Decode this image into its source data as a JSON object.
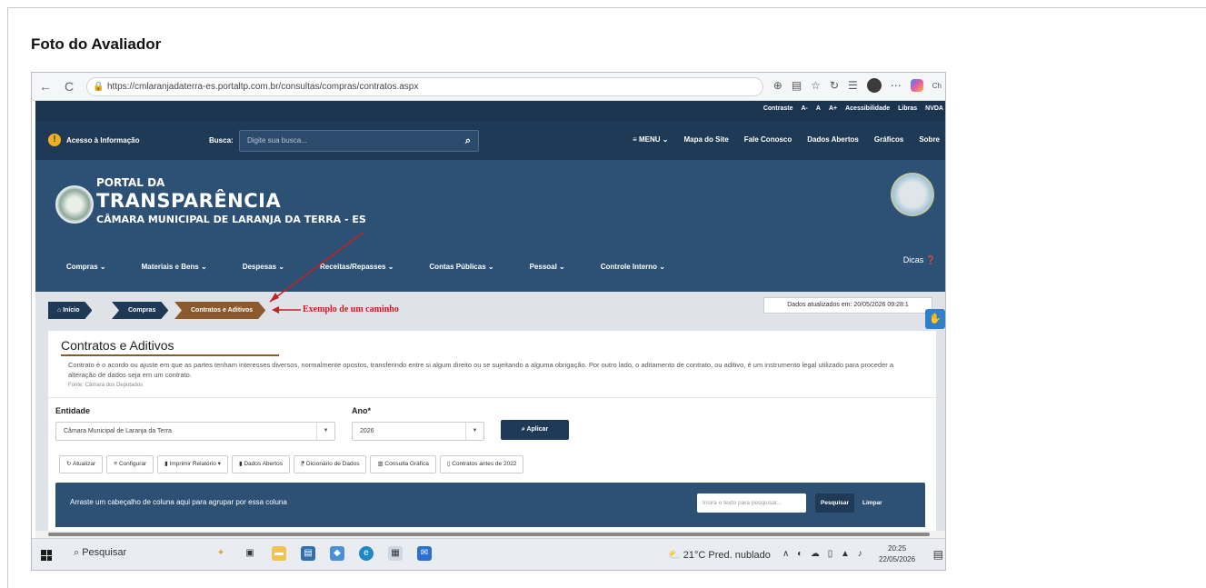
{
  "page": {
    "title": "Foto do Avaliador"
  },
  "browser": {
    "url": "https://cmlaranjadaterra-es.portaltp.com.br/consultas/compras/contratos.aspx",
    "back_icon": "←",
    "reload_icon": "C",
    "profile_label": "Ch"
  },
  "util_bar": {
    "items": [
      "Contraste",
      "A-",
      "A",
      "A+",
      "Acessibilidade",
      "Libras",
      "NVDA"
    ]
  },
  "search_bar": {
    "access_label": "Acesso à Informação",
    "busca_label": "Busca:",
    "placeholder": "Digite sua busca...",
    "nav": [
      "≡ MENU ⌄",
      "Mapa do Site",
      "Fale Conosco",
      "Dados Abertos",
      "Gráficos",
      "Sobre"
    ]
  },
  "banner": {
    "line1": "PORTAL DA",
    "line2": "TRANSPARÊNCIA",
    "line3": "CÂMARA MUNICIPAL DE LARANJA DA TERRA - ES",
    "menu": [
      "Compras ⌄",
      "Materiais e Bens ⌄",
      "Despesas ⌄",
      "Receitas/Repasses ⌄",
      "Contas Públicas ⌄",
      "Pessoal ⌄",
      "Controle Interno ⌄"
    ],
    "dicas": "Dicas"
  },
  "breadcrumb": {
    "items": [
      "Início",
      "Compras",
      "Contratos e Aditivos"
    ],
    "annotation": "Exemplo de um caminho",
    "updated": "Dados atualizados em: 20/05/2026 09:28:1"
  },
  "content": {
    "title": "Contratos e Aditivos",
    "description": "Contrato é o acordo ou ajuste em que as partes tenham interesses diversos, normalmente opostos, transferindo entre si algum direito ou se sujeitando a alguma obrigação. Por outro lado, o aditamento de contrato, ou aditivo, é um instrumento legal utilizado para proceder a alteração de dados seja em um contrato.",
    "source": "Fonte: Câmara dos Deputados",
    "entidade_label": "Entidade",
    "entidade_value": "Câmara Municipal de Laranja da Terra",
    "ano_label": "Ano*",
    "ano_value": "2026",
    "aplicar": "Aplicar",
    "tools": [
      "Atualizar",
      "Configurar",
      "Imprimir Relatório",
      "Dados Abertos",
      "Dicionário de Dados",
      "Consulta Gráfica",
      "Contratos antes de 2022"
    ],
    "grid_hint": "Arraste um cabeçalho de coluna aqui para agrupar por essa coluna",
    "grid_search_placeholder": "Insira o texto para pesquisar...",
    "pesquisar": "Pesquisar",
    "limpar": "Limpar"
  },
  "taskbar": {
    "search": "Pesquisar",
    "weather": "21°C  Pred. nublado",
    "time": "20:25",
    "date": "22/05/2026"
  },
  "colors": {
    "navy": "#1f3a57",
    "banner": "#2d5175",
    "brown": "#8a5a2d",
    "annotation": "#c62020"
  }
}
